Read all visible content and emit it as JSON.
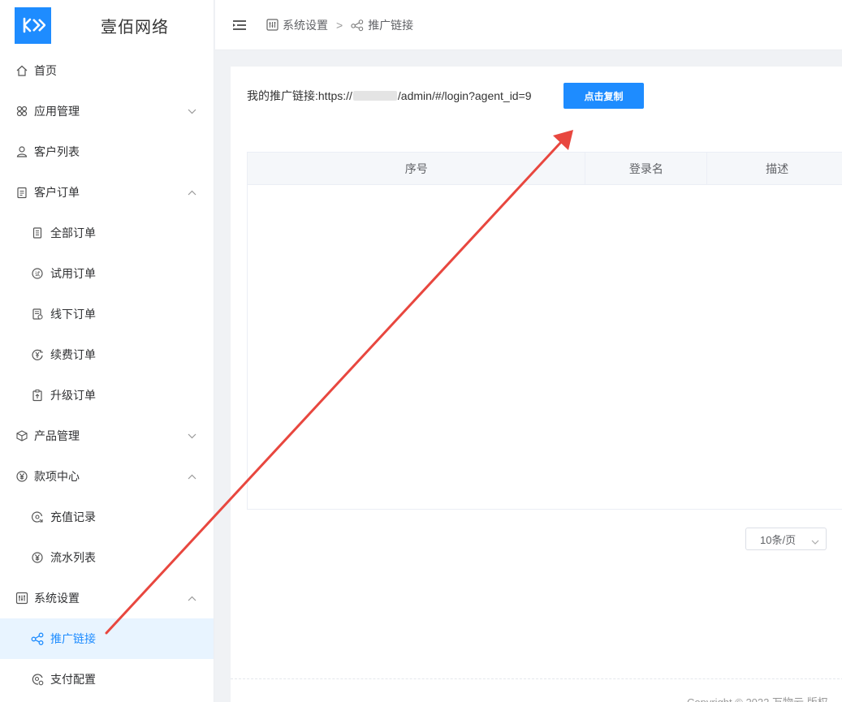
{
  "app": {
    "title": "壹佰网络"
  },
  "sidebar": {
    "items": [
      {
        "label": "首页",
        "icon": "home-icon"
      },
      {
        "label": "应用管理",
        "icon": "apps-icon",
        "chevron": "down"
      },
      {
        "label": "客户列表",
        "icon": "user-icon"
      },
      {
        "label": "客户订单",
        "icon": "clipboard-icon",
        "chevron": "up"
      },
      {
        "label": "全部订单",
        "icon": "document-icon",
        "sub": true
      },
      {
        "label": "试用订单",
        "icon": "trial-icon",
        "sub": true
      },
      {
        "label": "线下订单",
        "icon": "offline-order-icon",
        "sub": true
      },
      {
        "label": "续费订单",
        "icon": "renew-icon",
        "sub": true
      },
      {
        "label": "升级订单",
        "icon": "upgrade-icon",
        "sub": true
      },
      {
        "label": "产品管理",
        "icon": "box-icon",
        "chevron": "down"
      },
      {
        "label": "款项中心",
        "icon": "yen-icon",
        "chevron": "up"
      },
      {
        "label": "充值记录",
        "icon": "recharge-icon",
        "sub": true
      },
      {
        "label": "流水列表",
        "icon": "yen-icon",
        "sub": true
      },
      {
        "label": "系统设置",
        "icon": "settings-icon",
        "chevron": "up"
      },
      {
        "label": "推广链接",
        "icon": "share-icon",
        "sub": true,
        "active": true
      },
      {
        "label": "支付配置",
        "icon": "payment-settings-icon",
        "sub": true
      }
    ]
  },
  "breadcrumb": {
    "parent": "系统设置",
    "separator": ">",
    "current": "推广链接"
  },
  "promo": {
    "label": "我的推广链接:",
    "url_prefix": "https://",
    "url_suffix": "/admin/#/login?agent_id=9",
    "copy_label": "点击复制"
  },
  "table": {
    "columns": [
      "序号",
      "登录名",
      "描述"
    ]
  },
  "pagination": {
    "page_size": "10条/页"
  },
  "footer": {
    "text": "Copyright © 2022 万物云 版权"
  },
  "colors": {
    "accent": "#1e8cff",
    "annotation_arrow": "#e8473f"
  }
}
